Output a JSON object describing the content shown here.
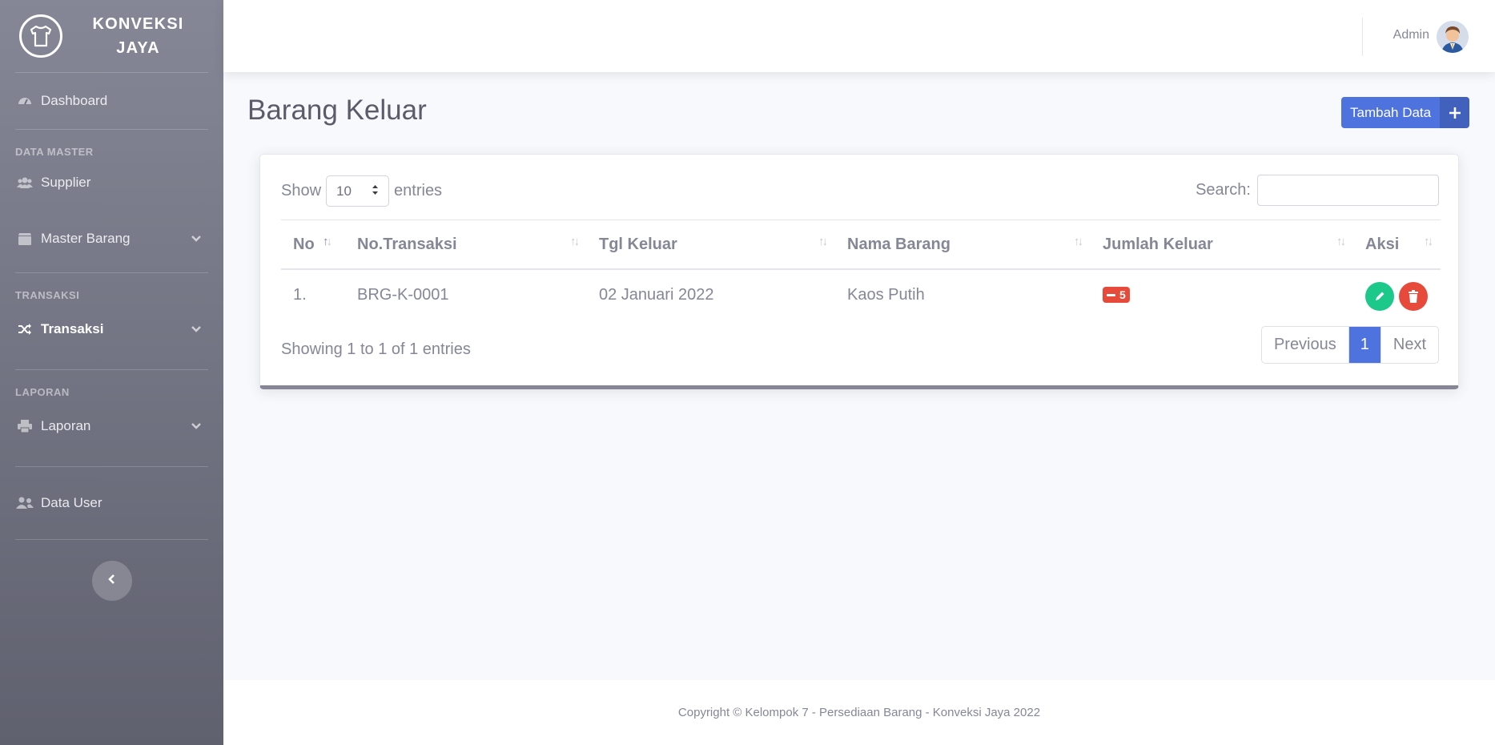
{
  "brand": {
    "line1": "KONVEKSI",
    "line2": "JAYA"
  },
  "sidebar": {
    "dashboard": "Dashboard",
    "heading_master": "DATA MASTER",
    "supplier": "Supplier",
    "master_barang": "Master Barang",
    "heading_transaksi": "TRANSAKSI",
    "transaksi": "Transaksi",
    "heading_laporan": "LAPORAN",
    "laporan": "Laporan",
    "data_user": "Data User"
  },
  "topbar": {
    "user_name": "Admin"
  },
  "page": {
    "title": "Barang Keluar",
    "add_button": "Tambah Data"
  },
  "table_controls": {
    "show_label": "Show",
    "entries_value": "10",
    "entries_label": "entries",
    "search_label": "Search:",
    "search_placeholder": ""
  },
  "table": {
    "columns": [
      "No",
      "No.Transaksi",
      "Tgl Keluar",
      "Nama Barang",
      "Jumlah Keluar",
      "Aksi"
    ],
    "rows": [
      {
        "no": "1.",
        "no_transaksi": "BRG-K-0001",
        "tgl_keluar": "02 Januari 2022",
        "nama_barang": "Kaos Putih",
        "jumlah_keluar": "5"
      }
    ]
  },
  "pagination": {
    "info": "Showing 1 to 1 of 1 entries",
    "previous": "Previous",
    "current": "1",
    "next": "Next"
  },
  "footer": {
    "text": "Copyright © Kelompok 7 - Persediaan Barang - Konveksi Jaya 2022"
  },
  "colors": {
    "primary": "#4e73df",
    "success": "#1cc88a",
    "danger": "#e74a3b",
    "sidebar": "#858796"
  }
}
